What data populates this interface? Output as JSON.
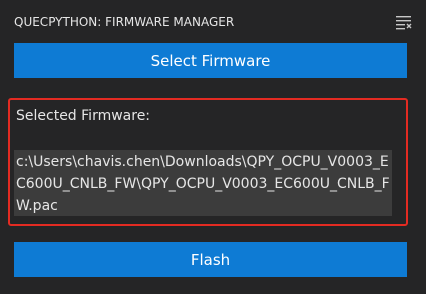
{
  "header": {
    "title": "QUECPYTHON: FIRMWARE MANAGER",
    "menu_icon": "collapse-list-icon"
  },
  "select_button": {
    "label": "Select Firmware"
  },
  "selected": {
    "label": "Selected Firmware:",
    "path": "c:\\Users\\chavis.chen\\Downloads\\QPY_OCPU_V0003_EC600U_CNLB_FW\\QPY_OCPU_V0003_EC600U_CNLB_FW.pac"
  },
  "flash_button": {
    "label": "Flash"
  },
  "colors": {
    "background": "#252526",
    "accent": "#0e7bd4",
    "highlight_border": "#e32b22",
    "field": "#3c3c3c"
  }
}
